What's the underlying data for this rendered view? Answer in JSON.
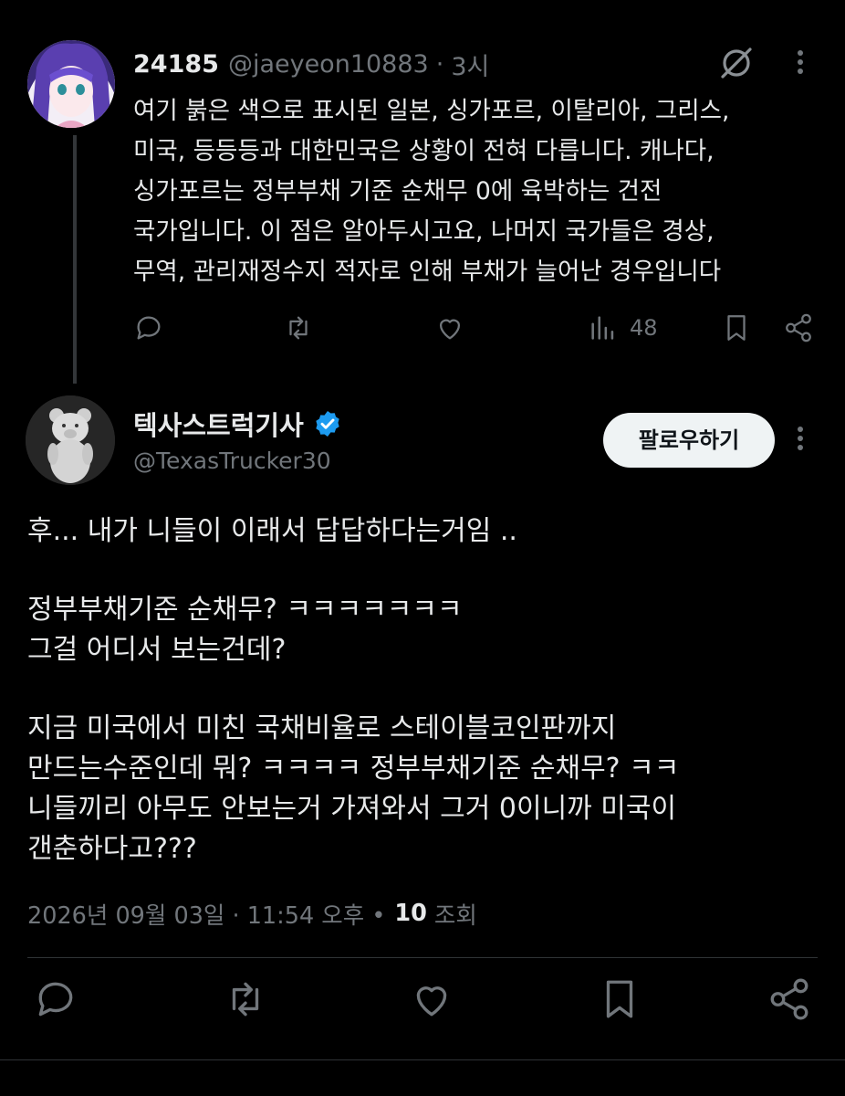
{
  "reply_tweet": {
    "display_name": "24185",
    "handle": "@jaeyeon10883",
    "separator": "·",
    "time": "3시",
    "body_lines": [
      "여기 붉은 색으로 표시된 일본, 싱가포르, 이탈리아, 그리스,",
      "미국, 등등등과 대한민국은 상황이 전혀 다릅니다. 캐나다,",
      "싱가포르는 정부부채 기준 순채무 0에 육박하는 건전",
      "국가입니다. 이 점은 알아두시고요, 나머지 국가들은 경상,",
      "무역, 관리재정수지 적자로 인해 부채가 늘어난 경우입니다"
    ],
    "views_count": "48"
  },
  "main_tweet": {
    "display_name": "텍사스트럭기사",
    "handle": "@TexasTrucker30",
    "follow_label": "팔로우하기",
    "body_lines": [
      "후... 내가 니들이 이래서 답답하다는거임 ..",
      "",
      "정부부채기준 순채무? ㅋㅋㅋㅋㅋㅋㅋ",
      "그걸 어디서 보는건데?",
      "",
      "지금 미국에서 미친 국채비율로 스테이블코인판까지",
      "만드는수준인데 뭐? ㅋㅋㅋㅋ 정부부채기준 순채무? ㅋㅋ",
      "니들끼리 아무도 안보는거 가져와서 그거 0이니까 미국이",
      "갠춘하다고???"
    ],
    "timestamp": "2026년 09월 03일 · 11:54 오후 •",
    "views_count": "10",
    "views_label": "조회"
  },
  "colors": {
    "background": "#000000",
    "text": "#e7e9ea",
    "muted": "#71767b",
    "verified": "#1d9bf0",
    "follow_bg": "#eff3f4"
  },
  "icons": [
    "grok-icon",
    "more-icon",
    "reply-icon",
    "retweet-icon",
    "like-icon",
    "views-icon",
    "bookmark-icon",
    "share-icon",
    "verified-badge-icon"
  ]
}
